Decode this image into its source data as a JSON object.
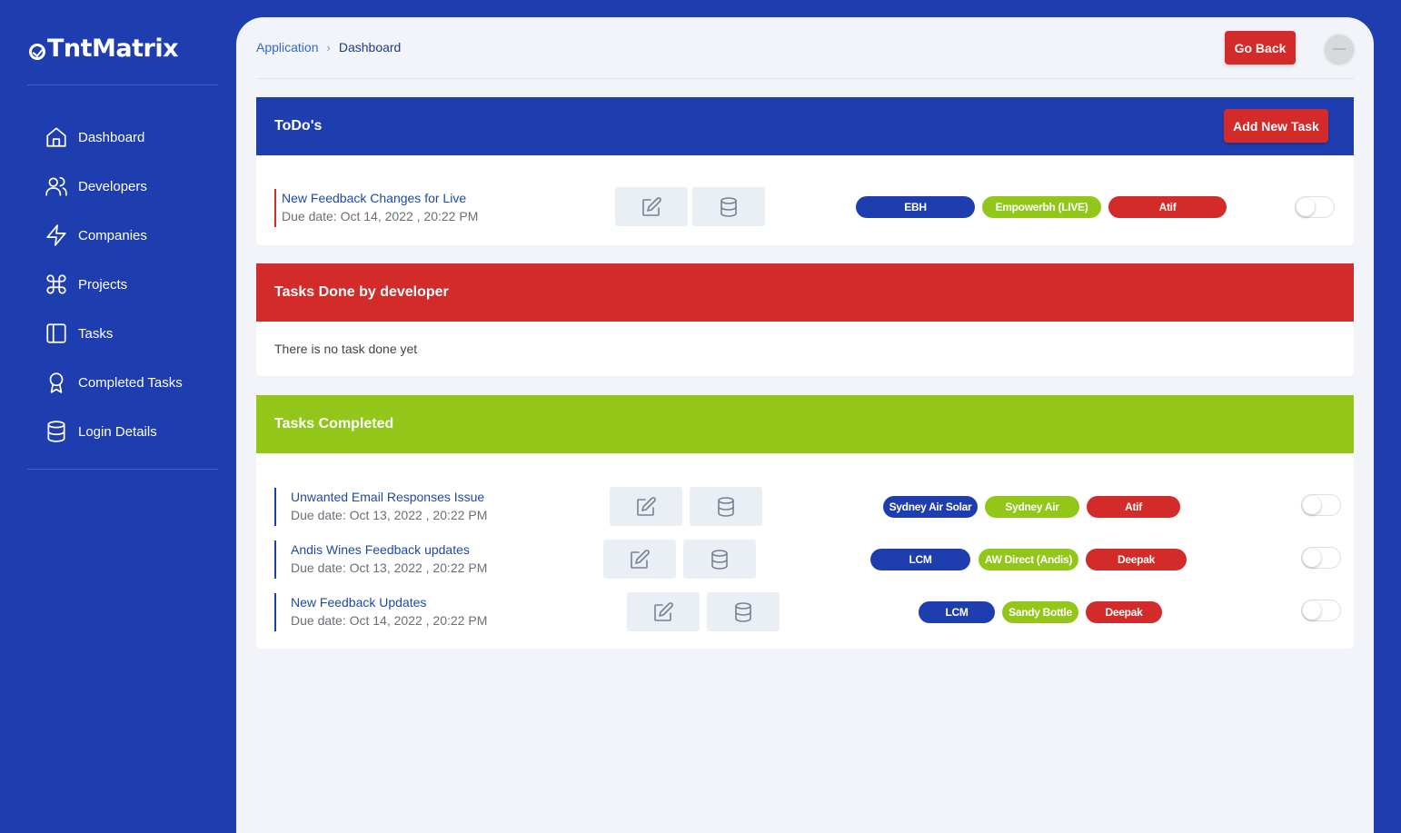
{
  "brand": {
    "name": "TntMatrix"
  },
  "sidebar": {
    "items": [
      {
        "label": "Dashboard",
        "icon": "home-icon"
      },
      {
        "label": "Developers",
        "icon": "users-icon"
      },
      {
        "label": "Companies",
        "icon": "zap-icon"
      },
      {
        "label": "Projects",
        "icon": "command-icon"
      },
      {
        "label": "Tasks",
        "icon": "sidebar-panel-icon"
      },
      {
        "label": "Completed Tasks",
        "icon": "award-icon"
      },
      {
        "label": "Login Details",
        "icon": "database-icon"
      }
    ]
  },
  "header": {
    "breadcrumb": {
      "parent": "Application",
      "separator": "›",
      "current": "Dashboard"
    },
    "go_back_label": "Go Back"
  },
  "todos": {
    "title": "ToDo's",
    "add_label": "Add New Task",
    "tasks": [
      {
        "title": "New Feedback Changes for Live",
        "due": "Due date: Oct 14, 2022 , 20:22 PM",
        "tags": [
          "EBH",
          "Empowerbh (LIVE)",
          "Atif"
        ]
      }
    ]
  },
  "done_by_dev": {
    "title": "Tasks Done by developer",
    "empty_message": "There is no task done yet"
  },
  "completed": {
    "title": "Tasks Completed",
    "tasks": [
      {
        "title": "Unwanted Email Responses Issue",
        "due": "Due date: Oct 13, 2022 , 20:22 PM",
        "tags": [
          "Sydney Air Solar",
          "Sydney Air",
          "Atif"
        ]
      },
      {
        "title": "Andis Wines Feedback updates",
        "due": "Due date: Oct 13, 2022 , 20:22 PM",
        "tags": [
          "LCM",
          "AW Direct (Andis)",
          "Deepak"
        ]
      },
      {
        "title": "New Feedback Updates",
        "due": "Due date: Oct 14, 2022 , 20:22 PM",
        "tags": [
          "LCM",
          "Sandy Bottle",
          "Deepak"
        ]
      }
    ]
  },
  "colors": {
    "primary_blue": "#1e3eb0",
    "danger_red": "#d32a2a",
    "success_green": "#92c71a",
    "panel_bg": "#f2f4f9"
  }
}
